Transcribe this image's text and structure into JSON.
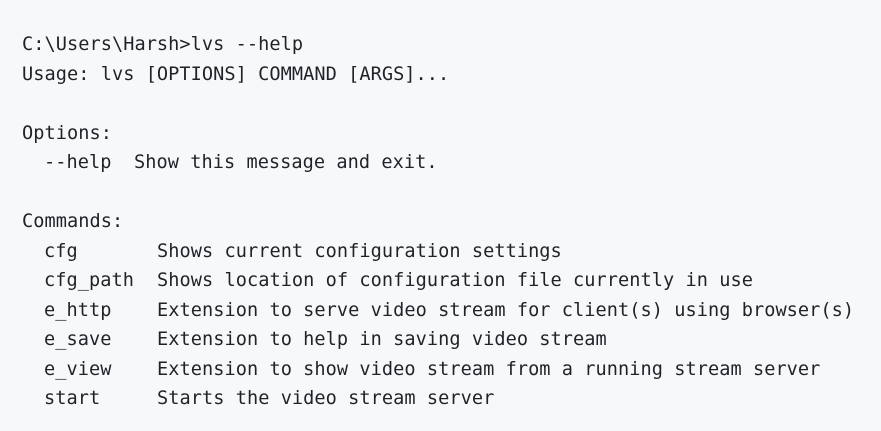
{
  "prompt": {
    "path": "C:\\Users\\Harsh>",
    "command": "lvs --help"
  },
  "usage": "Usage: lvs [OPTIONS] COMMAND [ARGS]...",
  "options": {
    "header": "Options:",
    "items": [
      {
        "name": "--help",
        "description": "Show this message and exit."
      }
    ]
  },
  "commands": {
    "header": "Commands:",
    "items": [
      {
        "name": "cfg",
        "description": "Shows current configuration settings"
      },
      {
        "name": "cfg_path",
        "description": "Shows location of configuration file currently in use"
      },
      {
        "name": "e_http",
        "description": "Extension to serve video stream for client(s) using browser(s)"
      },
      {
        "name": "e_save",
        "description": "Extension to help in saving video stream"
      },
      {
        "name": "e_view",
        "description": "Extension to show video stream from a running stream server"
      },
      {
        "name": "start",
        "description": "Starts the video stream server"
      }
    ]
  }
}
